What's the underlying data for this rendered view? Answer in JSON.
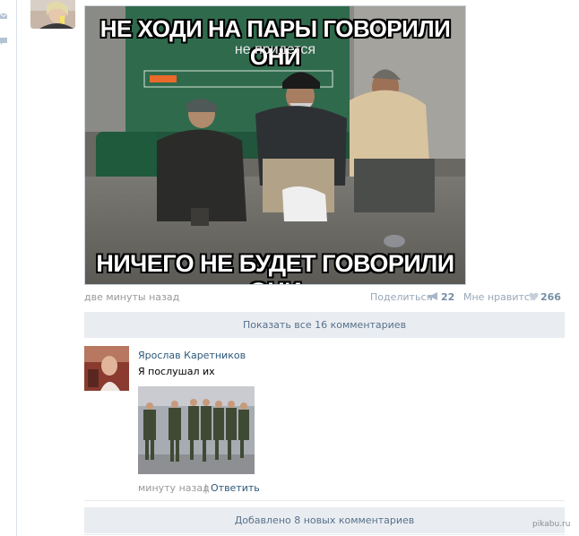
{
  "post": {
    "meme_top": "НЕ ХОДИ НА ПАРЫ ГОВОРИЛИ ОНИ",
    "meme_sub": "не придется",
    "meme_bottom": "НИЧЕГО НЕ БУДЕТ ГОВОРИЛИ ОНИ",
    "time": "две минуты назад",
    "share_label": "Поделиться",
    "share_count": "22",
    "like_label": "Мне нравится",
    "like_count": "266"
  },
  "comments": {
    "show_all_label": "Показать все 16 комментариев",
    "new_comments_label": "Добавлено 8 новых комментариев",
    "items": [
      {
        "author": "Ярослав Каретников",
        "text": "Я послушал их",
        "time": "минуту назад",
        "separator": "|",
        "reply_label": "Ответить"
      }
    ]
  },
  "watermark": "pikabu.ru",
  "icons": [
    "mail-icon",
    "comment-icon",
    "megaphone-icon",
    "heart-icon"
  ],
  "colors": {
    "link": "#2b587a",
    "muted": "#999999",
    "bar_bg": "#e9edf1",
    "bar_text": "#58708b",
    "count": "#778ea5"
  }
}
